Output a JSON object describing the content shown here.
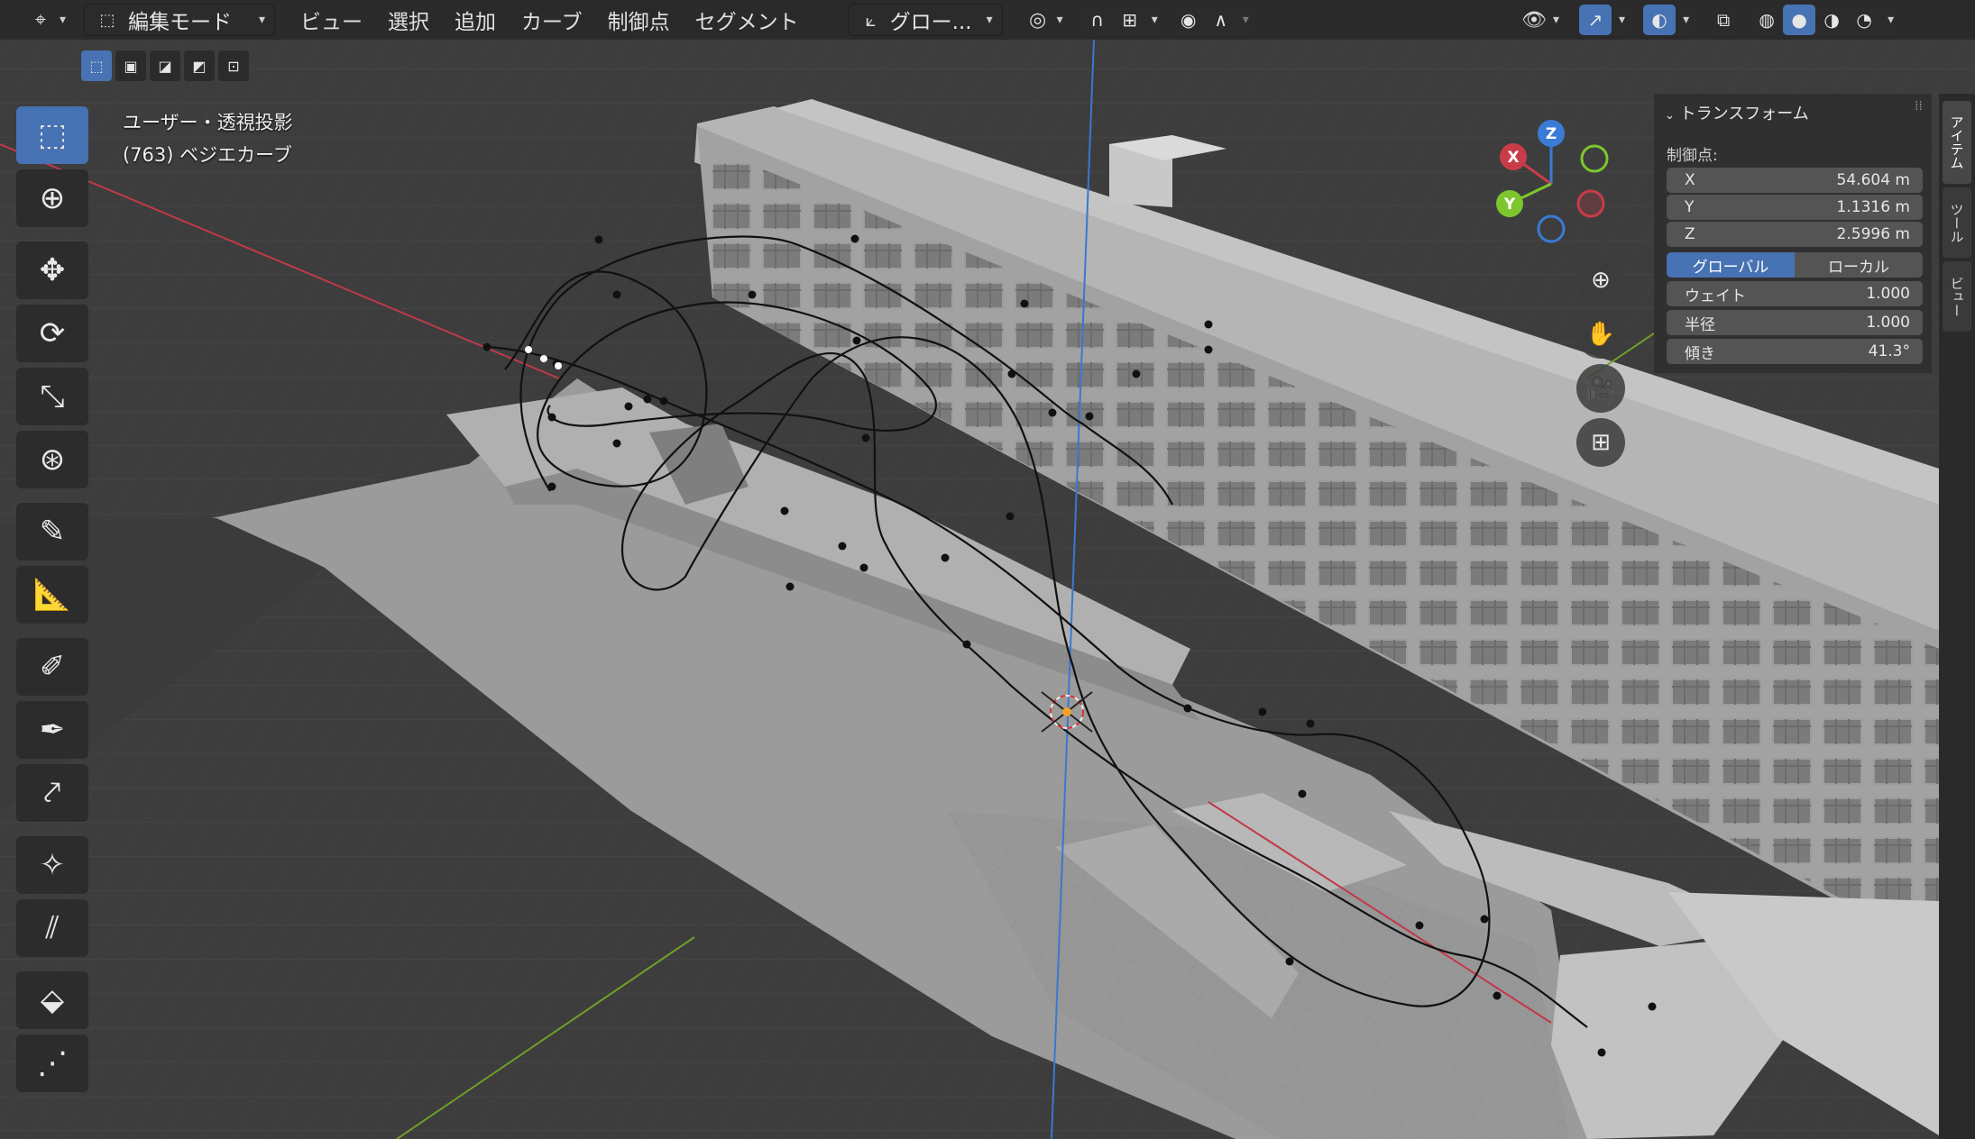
{
  "header": {
    "editor_icon": "editor-type-icon",
    "mode_label": "編集モード",
    "menu": [
      "ビュー",
      "選択",
      "追加",
      "カーブ",
      "制御点",
      "セグメント"
    ],
    "orientation_label": "グロー...",
    "pivot_icon": "pivot-point-icon",
    "snap_icon": "snap-magnet-icon",
    "proportional_icon": "proportional-edit-icon"
  },
  "viewport": {
    "view_label": "ユーザー・透視投影",
    "object_label": "(763) ベジエカーブ"
  },
  "gizmo": {
    "x": "X",
    "y": "Y",
    "z": "Z",
    "x_color": "#c83c4a",
    "y_color": "#7dc62e",
    "z_color": "#3a7bd5"
  },
  "transform_panel": {
    "title": "トランスフォーム",
    "section_label": "制御点:",
    "x": {
      "label": "X",
      "value": "54.604 m"
    },
    "y": {
      "label": "Y",
      "value": "1.1316 m"
    },
    "z": {
      "label": "Z",
      "value": "2.5996 m"
    },
    "toggle": {
      "global": "グローバル",
      "local": "ローカル"
    },
    "weight": {
      "label": "ウェイト",
      "value": "1.000"
    },
    "radius": {
      "label": "半径",
      "value": "1.000"
    },
    "tilt": {
      "label": "傾き",
      "value": "41.3°"
    }
  },
  "side_tabs": [
    "アイテム",
    "ツール",
    "ビュー"
  ],
  "colors": {
    "accent": "#4772b3",
    "header_bg": "#282828",
    "panel_bg": "#303030",
    "field_bg": "#545454"
  }
}
